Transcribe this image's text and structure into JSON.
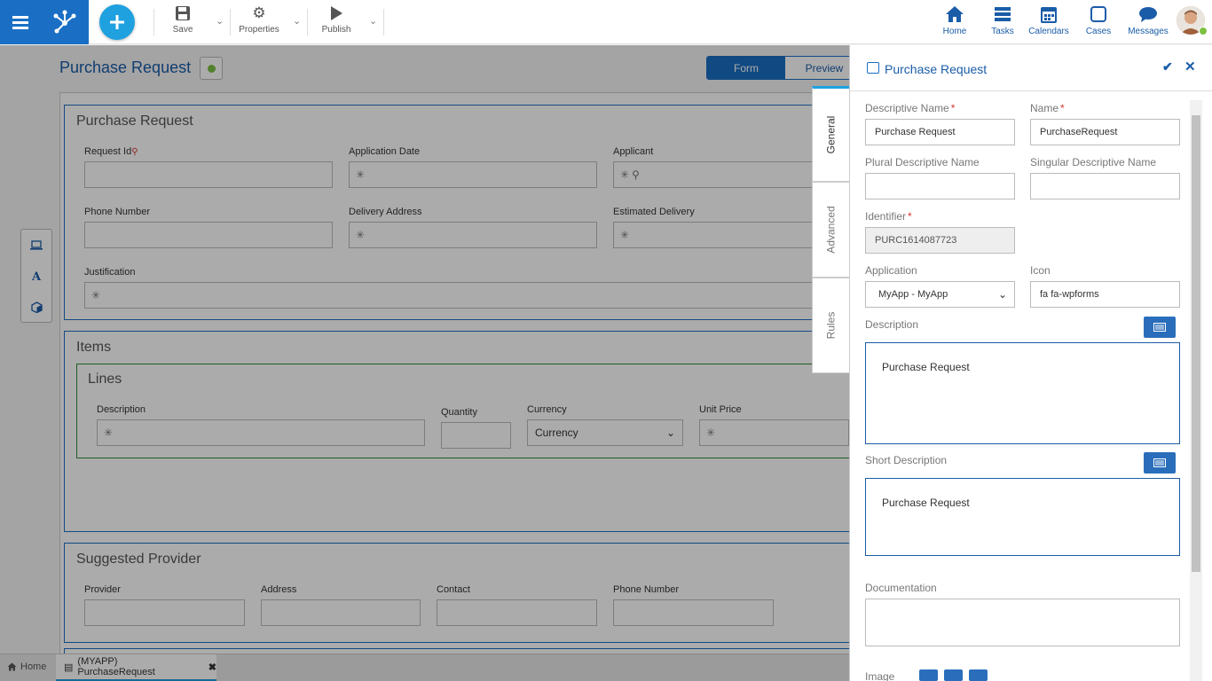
{
  "toolbar": {
    "save": "Save",
    "properties": "Properties",
    "publish": "Publish"
  },
  "nav": {
    "home": "Home",
    "tasks": "Tasks",
    "calendars": "Calendars",
    "cases": "Cases",
    "messages": "Messages"
  },
  "form": {
    "title": "Purchase Request",
    "view_tabs": [
      "Form",
      "Preview"
    ],
    "sections": {
      "purchase_request": {
        "title": "Purchase Request",
        "fields": {
          "request_id": "Request Id",
          "application_date": "Application Date",
          "applicant": "Applicant",
          "phone_number": "Phone Number",
          "delivery_address": "Delivery Address",
          "estimated_delivery": "Estimated Delivery",
          "justification": "Justification"
        }
      },
      "items": {
        "title": "Items",
        "lines": {
          "title": "Lines",
          "description": "Description",
          "quantity": "Quantity",
          "currency": "Currency",
          "currency_value": "Currency",
          "unit_price": "Unit Price"
        }
      },
      "suggested_provider": {
        "title": "Suggested Provider",
        "provider": "Provider",
        "address": "Address",
        "contact": "Contact",
        "phone_number": "Phone Number"
      }
    }
  },
  "taskbar": {
    "home": "Home",
    "tab": "(MYAPP) PurchaseRequest"
  },
  "panel": {
    "title": "Purchase Request",
    "tabs": [
      "General",
      "Advanced",
      "Rules"
    ],
    "descriptive_name_label": "Descriptive Name",
    "descriptive_name_value": "Purchase Request",
    "name_label": "Name",
    "name_value": "PurchaseRequest",
    "plural_label": "Plural Descriptive Name",
    "singular_label": "Singular Descriptive Name",
    "identifier_label": "Identifier",
    "identifier_value": "PURC1614087723",
    "application_label": "Application",
    "application_value": "MyApp - MyApp",
    "icon_label": "Icon",
    "icon_value": "fa fa-wpforms",
    "description_label": "Description",
    "description_value": "Purchase Request",
    "short_description_label": "Short Description",
    "short_description_value": "Purchase Request",
    "documentation_label": "Documentation",
    "image_label": "Image",
    "required_mark": "*"
  },
  "colors": {
    "primary": "#1a6fc4",
    "accent": "#1fa1e0",
    "status_green": "#7cc142",
    "required": "#d9332b"
  }
}
